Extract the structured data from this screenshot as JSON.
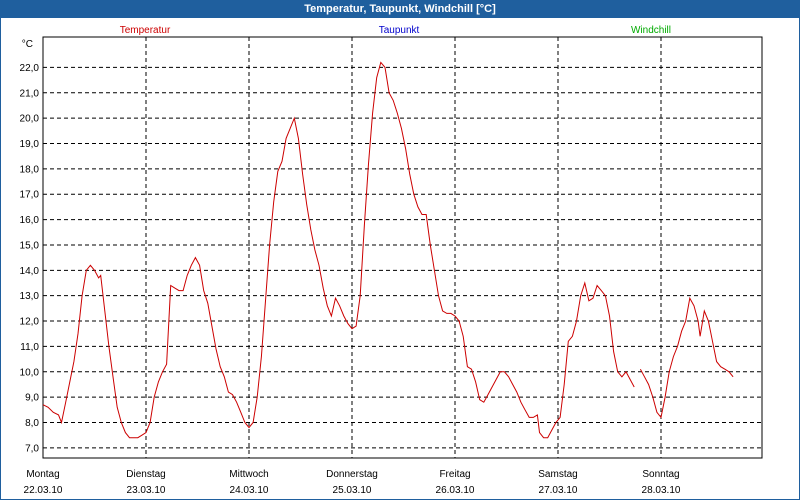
{
  "window": {
    "title": "Temperatur, Taupunkt, Windchill [°C]"
  },
  "chart_data": {
    "type": "line",
    "title": "Temperatur, Taupunkt, Windchill [°C]",
    "ylabel": "°C",
    "ylim": [
      6.6,
      23.2
    ],
    "y_ticks": [
      "7,0",
      "8,0",
      "9,0",
      "10,0",
      "11,0",
      "12,0",
      "13,0",
      "14,0",
      "15,0",
      "16,0",
      "17,0",
      "18,0",
      "19,0",
      "20,0",
      "21,0",
      "22,0"
    ],
    "y_tick_values": [
      7,
      8,
      9,
      10,
      11,
      12,
      13,
      14,
      15,
      16,
      17,
      18,
      19,
      20,
      21,
      22
    ],
    "grid": true,
    "legend_placement": "top",
    "x_day_labels": [
      {
        "day": "Montag",
        "date": "22.03.10"
      },
      {
        "day": "Dienstag",
        "date": "23.03.10"
      },
      {
        "day": "Mittwoch",
        "date": "24.03.10"
      },
      {
        "day": "Donnerstag",
        "date": "25.03.10"
      },
      {
        "day": "Freitag",
        "date": "26.03.10"
      },
      {
        "day": "Samstag",
        "date": "27.03.10"
      },
      {
        "day": "Sonntag",
        "date": "28.03.10"
      }
    ],
    "x_range_days": [
      0,
      7
    ],
    "series": [
      {
        "name": "Temperatur",
        "color": "#cc0000",
        "segments": [
          [
            [
              0.0,
              8.7
            ],
            [
              0.05,
              8.6
            ],
            [
              0.1,
              8.4
            ],
            [
              0.15,
              8.3
            ],
            [
              0.18,
              8.0
            ],
            [
              0.22,
              8.8
            ],
            [
              0.26,
              9.6
            ],
            [
              0.3,
              10.4
            ],
            [
              0.34,
              11.5
            ],
            [
              0.38,
              13.0
            ],
            [
              0.42,
              14.0
            ],
            [
              0.46,
              14.2
            ],
            [
              0.5,
              14.0
            ],
            [
              0.54,
              13.7
            ],
            [
              0.56,
              13.8
            ],
            [
              0.6,
              12.4
            ],
            [
              0.64,
              11.0
            ],
            [
              0.68,
              9.8
            ],
            [
              0.72,
              8.6
            ],
            [
              0.76,
              8.0
            ],
            [
              0.8,
              7.6
            ],
            [
              0.84,
              7.4
            ],
            [
              0.88,
              7.4
            ],
            [
              0.92,
              7.4
            ],
            [
              0.96,
              7.5
            ],
            [
              1.0,
              7.6
            ],
            [
              1.04,
              8.0
            ],
            [
              1.08,
              9.0
            ],
            [
              1.12,
              9.6
            ],
            [
              1.16,
              10.0
            ],
            [
              1.2,
              10.3
            ],
            [
              1.24,
              13.4
            ],
            [
              1.28,
              13.3
            ],
            [
              1.32,
              13.2
            ],
            [
              1.36,
              13.2
            ],
            [
              1.4,
              13.8
            ],
            [
              1.44,
              14.2
            ],
            [
              1.48,
              14.5
            ],
            [
              1.52,
              14.2
            ],
            [
              1.56,
              13.2
            ],
            [
              1.6,
              12.7
            ],
            [
              1.64,
              11.8
            ],
            [
              1.68,
              10.9
            ],
            [
              1.72,
              10.2
            ],
            [
              1.76,
              9.8
            ],
            [
              1.8,
              9.2
            ],
            [
              1.84,
              9.1
            ],
            [
              1.88,
              8.8
            ],
            [
              1.92,
              8.4
            ],
            [
              1.96,
              8.0
            ],
            [
              2.0,
              7.8
            ],
            [
              2.04,
              8.0
            ],
            [
              2.08,
              9.0
            ],
            [
              2.12,
              10.6
            ],
            [
              2.16,
              12.8
            ],
            [
              2.2,
              15.0
            ],
            [
              2.24,
              16.7
            ],
            [
              2.28,
              17.9
            ],
            [
              2.32,
              18.3
            ],
            [
              2.36,
              19.2
            ],
            [
              2.4,
              19.6
            ],
            [
              2.44,
              20.0
            ],
            [
              2.48,
              19.2
            ],
            [
              2.52,
              17.8
            ],
            [
              2.56,
              16.6
            ],
            [
              2.6,
              15.6
            ],
            [
              2.64,
              14.8
            ],
            [
              2.68,
              14.2
            ],
            [
              2.72,
              13.3
            ],
            [
              2.76,
              12.6
            ],
            [
              2.8,
              12.2
            ],
            [
              2.84,
              12.9
            ],
            [
              2.88,
              12.6
            ],
            [
              2.92,
              12.2
            ],
            [
              2.96,
              11.9
            ],
            [
              3.0,
              11.7
            ],
            [
              3.04,
              11.8
            ],
            [
              3.08,
              13.0
            ],
            [
              3.12,
              15.8
            ],
            [
              3.16,
              18.2
            ],
            [
              3.2,
              20.2
            ],
            [
              3.24,
              21.6
            ],
            [
              3.28,
              22.2
            ],
            [
              3.32,
              22.0
            ],
            [
              3.36,
              21.0
            ],
            [
              3.4,
              20.7
            ],
            [
              3.44,
              20.2
            ],
            [
              3.48,
              19.6
            ],
            [
              3.52,
              18.8
            ],
            [
              3.56,
              17.8
            ],
            [
              3.6,
              17.0
            ],
            [
              3.64,
              16.5
            ],
            [
              3.68,
              16.2
            ],
            [
              3.72,
              16.2
            ],
            [
              3.76,
              15.0
            ],
            [
              3.8,
              14.0
            ],
            [
              3.84,
              13.0
            ],
            [
              3.88,
              12.4
            ],
            [
              3.92,
              12.3
            ],
            [
              3.96,
              12.3
            ],
            [
              4.0,
              12.2
            ],
            [
              4.04,
              12.0
            ],
            [
              4.08,
              11.4
            ],
            [
              4.12,
              10.2
            ],
            [
              4.16,
              10.1
            ],
            [
              4.2,
              9.6
            ],
            [
              4.24,
              8.9
            ],
            [
              4.28,
              8.8
            ],
            [
              4.32,
              9.1
            ],
            [
              4.36,
              9.4
            ],
            [
              4.4,
              9.7
            ],
            [
              4.44,
              10.0
            ],
            [
              4.48,
              10.0
            ],
            [
              4.52,
              9.8
            ],
            [
              4.56,
              9.5
            ],
            [
              4.6,
              9.2
            ],
            [
              4.64,
              8.8
            ],
            [
              4.68,
              8.5
            ],
            [
              4.72,
              8.2
            ],
            [
              4.76,
              8.2
            ],
            [
              4.8,
              8.3
            ],
            [
              4.82,
              7.6
            ],
            [
              4.86,
              7.4
            ],
            [
              4.9,
              7.4
            ],
            [
              4.94,
              7.7
            ],
            [
              4.98,
              8.0
            ],
            [
              5.02,
              8.2
            ],
            [
              5.06,
              9.5
            ],
            [
              5.1,
              11.2
            ],
            [
              5.14,
              11.4
            ],
            [
              5.18,
              12.0
            ],
            [
              5.22,
              13.0
            ],
            [
              5.26,
              13.5
            ],
            [
              5.3,
              12.8
            ],
            [
              5.34,
              12.9
            ],
            [
              5.38,
              13.4
            ],
            [
              5.42,
              13.2
            ],
            [
              5.46,
              13.0
            ],
            [
              5.5,
              12.2
            ],
            [
              5.54,
              10.8
            ],
            [
              5.58,
              10.0
            ],
            [
              5.62,
              9.8
            ],
            [
              5.66,
              10.0
            ],
            [
              5.7,
              9.7
            ],
            [
              5.74,
              9.4
            ]
          ],
          [
            [
              5.8,
              10.1
            ],
            [
              5.84,
              9.8
            ],
            [
              5.88,
              9.5
            ],
            [
              5.92,
              9.0
            ],
            [
              5.96,
              8.4
            ],
            [
              6.0,
              8.2
            ],
            [
              6.04,
              9.0
            ],
            [
              6.08,
              10.0
            ],
            [
              6.12,
              10.6
            ],
            [
              6.16,
              11.0
            ],
            [
              6.2,
              11.6
            ],
            [
              6.24,
              12.0
            ],
            [
              6.28,
              12.9
            ],
            [
              6.32,
              12.6
            ],
            [
              6.36,
              12.0
            ],
            [
              6.38,
              11.4
            ],
            [
              6.42,
              12.4
            ],
            [
              6.46,
              12.0
            ],
            [
              6.5,
              11.2
            ],
            [
              6.54,
              10.4
            ],
            [
              6.58,
              10.2
            ],
            [
              6.62,
              10.1
            ],
            [
              6.66,
              10.0
            ],
            [
              6.7,
              9.8
            ]
          ]
        ]
      },
      {
        "name": "Taupunkt",
        "color": "#0000cc",
        "segments": []
      },
      {
        "name": "Windchill",
        "color": "#00aa00",
        "segments": []
      }
    ]
  }
}
